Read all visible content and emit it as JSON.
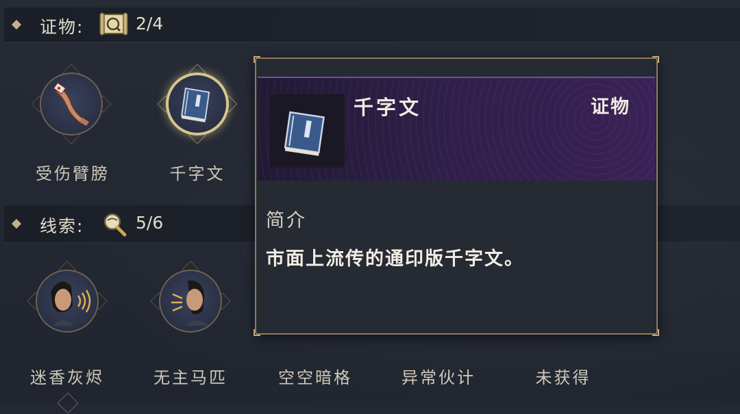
{
  "evidence_section": {
    "title": "证物:",
    "count": "2/4",
    "items": [
      {
        "label": "受伤臂膀",
        "icon": "injured-arm-icon",
        "selected": false
      },
      {
        "label": "千字文",
        "icon": "book-icon",
        "selected": true
      }
    ]
  },
  "clue_section": {
    "title": "线索:",
    "count": "5/6",
    "items": [
      {
        "label": "迷香灰烬",
        "icon": "man-smelling-icon"
      },
      {
        "label": "无主马匹",
        "icon": "man-breathing-icon"
      },
      {
        "label": "空空暗格",
        "icon": "man-listening-icon"
      },
      {
        "label": "异常伙计",
        "icon": "man-breathing-icon"
      },
      {
        "label": "未获得",
        "icon": "question-mark-icon"
      }
    ]
  },
  "tooltip": {
    "name": "千字文",
    "type": "证物",
    "desc_heading": "简介",
    "desc_text": "市面上流传的通印版千字文。"
  },
  "colors": {
    "accent_gold": "#d7c58f",
    "rarity_purple": "#3a2256",
    "background": "#232833"
  }
}
